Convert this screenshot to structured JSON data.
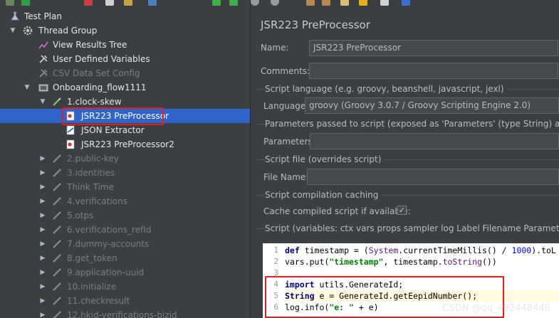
{
  "tree": {
    "items": [
      {
        "label": "Test Plan",
        "icon": "flask-icon",
        "state": "on"
      },
      {
        "label": "Thread Group",
        "icon": "gear-icon",
        "state": "on"
      },
      {
        "label": "View Results Tree",
        "icon": "chart-icon",
        "state": "on"
      },
      {
        "label": "User Defined Variables",
        "icon": "wrench-icon",
        "state": "on"
      },
      {
        "label": "CSV Data Set Config",
        "icon": "wrench-icon",
        "state": "disabled"
      },
      {
        "label": "Onboarding_flow1111",
        "icon": "controller-icon",
        "state": "on"
      },
      {
        "label": "1.clock-skew",
        "icon": "pipette-icon",
        "state": "on"
      },
      {
        "label": "JSR223 PreProcessor",
        "icon": "preprocessor-icon",
        "state": "on"
      },
      {
        "label": "JSON Extractor",
        "icon": "extractor-icon",
        "state": "on"
      },
      {
        "label": "JSR223 PreProcessor2",
        "icon": "preprocessor-icon",
        "state": "on"
      },
      {
        "label": "2.public-key",
        "icon": "pipette-icon",
        "state": "disabled"
      },
      {
        "label": "3.identities",
        "icon": "pipette-icon",
        "state": "disabled"
      },
      {
        "label": "Think Time",
        "icon": "pipette-icon",
        "state": "disabled"
      },
      {
        "label": "4.verifications",
        "icon": "pipette-icon",
        "state": "disabled"
      },
      {
        "label": "5.otps",
        "icon": "pipette-icon",
        "state": "disabled"
      },
      {
        "label": "6.verifications_refId",
        "icon": "pipette-icon",
        "state": "disabled"
      },
      {
        "label": "7.dummy-accounts",
        "icon": "pipette-icon",
        "state": "disabled"
      },
      {
        "label": "8.get_token",
        "icon": "pipette-icon",
        "state": "disabled"
      },
      {
        "label": "9.application-uuid",
        "icon": "pipette-icon",
        "state": "disabled"
      },
      {
        "label": "10.initialize",
        "icon": "pipette-icon",
        "state": "disabled"
      },
      {
        "label": "11.checkresult",
        "icon": "pipette-icon",
        "state": "disabled"
      },
      {
        "label": "12.hkid-verifications-bizid",
        "icon": "pipette-icon",
        "state": "disabled"
      }
    ]
  },
  "panel": {
    "title": "JSR223 PreProcessor",
    "name_label": "Name:",
    "name_value": "JSR223 PreProcessor",
    "comments_label": "Comments:",
    "comments_value": "",
    "script_language_section": "Script language (e.g. groovy, beanshell, javascript, jexl)",
    "language_label": "Language:",
    "language_value": "groovy     (Groovy 3.0.7 / Groovy Scripting Engine 2.0)",
    "parameters_section": "Parameters passed to script (exposed as 'Parameters' (type String) and 'args' (ty",
    "parameters_label": "Parameters:",
    "parameters_value": "",
    "script_file_section": "Script file (overrides script)",
    "file_name_label": "File Name:",
    "file_name_value": "",
    "caching_section": "Script compilation caching",
    "cache_label": "Cache compiled script if available:",
    "cache_checked": "✓",
    "script_section": "Script (variables: ctx vars props sampler log Label Filename Parameters args OU"
  },
  "editor": {
    "line_numbers": [
      "1",
      "2",
      "3",
      "4",
      "5",
      "6"
    ],
    "current_line": 5
  },
  "watermark": "CSDN @qq_492448446",
  "colors": {
    "background": "#3c3f41",
    "selection": "#2f65ca",
    "highlight_box": "#e02020",
    "editor_bg": "#ffffff",
    "current_line": "#fffae0"
  }
}
